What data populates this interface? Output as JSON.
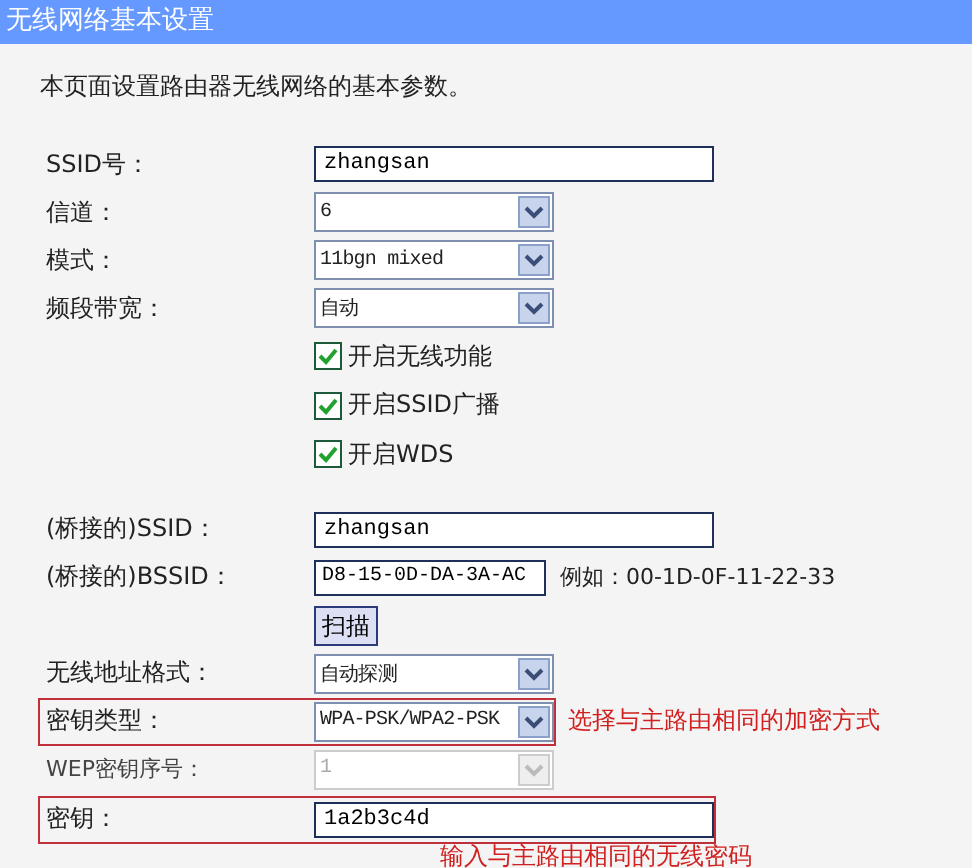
{
  "window": {
    "title": "无线网络基本设置"
  },
  "description": "本页面设置路由器无线网络的基本参数。",
  "fields": [
    {
      "kind": "text",
      "label": "SSID号：",
      "value": "zhangsan",
      "disabled": false,
      "highlighted": false
    },
    {
      "kind": "select",
      "label": "信道：",
      "value": "6",
      "disabled": false,
      "highlighted": false
    },
    {
      "kind": "select",
      "label": "模式：",
      "value": "11bgn mixed",
      "disabled": false,
      "highlighted": false
    },
    {
      "kind": "select",
      "label": "频段带宽：",
      "value": "自动",
      "disabled": false,
      "highlighted": false
    }
  ],
  "options": [
    {
      "label": "开启无线功能",
      "checked": true
    },
    {
      "label": "开启SSID广播",
      "checked": true
    },
    {
      "label": "开启WDS",
      "checked": true
    }
  ],
  "wds_fields": [
    {
      "kind": "text",
      "label": "(桥接的)SSID：",
      "value": "zhangsan",
      "disabled": false,
      "highlighted": false
    },
    {
      "kind": "short-text",
      "label": "(桥接的)BSSID：",
      "value": "D8-15-0D-DA-3A-AC",
      "hint": "例如：00-1D-0F-11-22-33",
      "disabled": false,
      "highlighted": false
    },
    {
      "kind": "button",
      "label": "扫描"
    },
    {
      "kind": "select",
      "label": "无线地址格式：",
      "value": "自动探测",
      "disabled": false,
      "highlighted": false
    },
    {
      "kind": "select",
      "label": "密钥类型：",
      "value": "WPA-PSK/WPA2-PSK",
      "disabled": false,
      "highlighted": true,
      "note": "选择与主路由相同的加密方式"
    },
    {
      "kind": "select",
      "label": "WEP密钥序号：",
      "value": "1",
      "disabled": true,
      "highlighted": false
    },
    {
      "kind": "text",
      "label": "密钥：",
      "value": "1a2b3c4d",
      "disabled": false,
      "highlighted": true,
      "note": "输入与主路由相同的无线密码"
    }
  ]
}
